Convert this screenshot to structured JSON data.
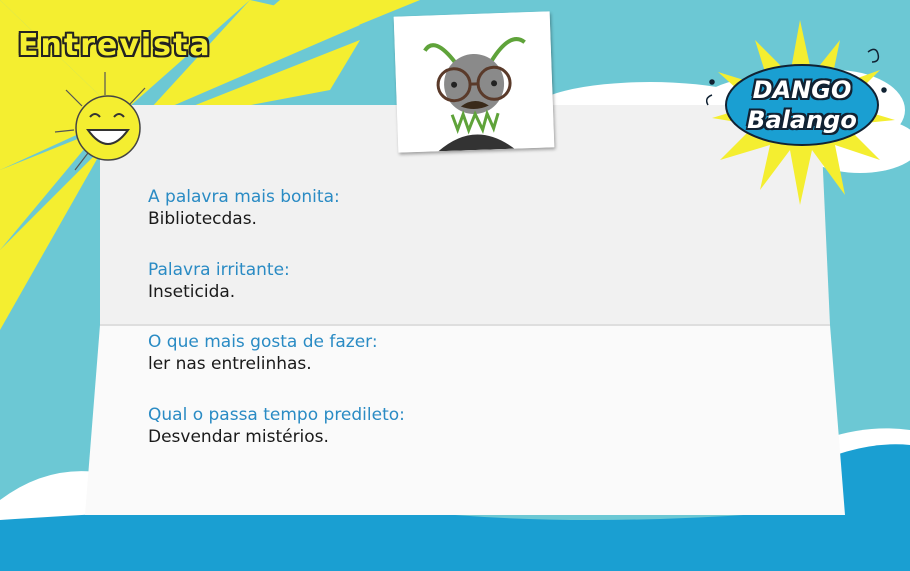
{
  "page": {
    "title": "Entrevista"
  },
  "logo": {
    "line1": "DANGO",
    "line2": "Balango"
  },
  "interview": [
    {
      "question": "A palavra mais bonita:",
      "answer": "Bibliotecdas."
    },
    {
      "question": "Palavra irritante:",
      "answer": "Inseticida."
    },
    {
      "question": "O que mais gosta de fazer:",
      "answer": "ler nas entrelinhas."
    },
    {
      "question": "Qual o passa tempo predileto:",
      "answer": "Desvendar mistérios."
    }
  ],
  "colors": {
    "background": "#6cc8d4",
    "sun": "#f4ee30",
    "question": "#2a8bc4",
    "answer": "#1a1a1a",
    "paper": "#f2f2f2",
    "bottom_wave": "#1a9fd2"
  },
  "icons": {
    "sun": "smiling-sun-icon",
    "portrait": "creature-portrait"
  }
}
